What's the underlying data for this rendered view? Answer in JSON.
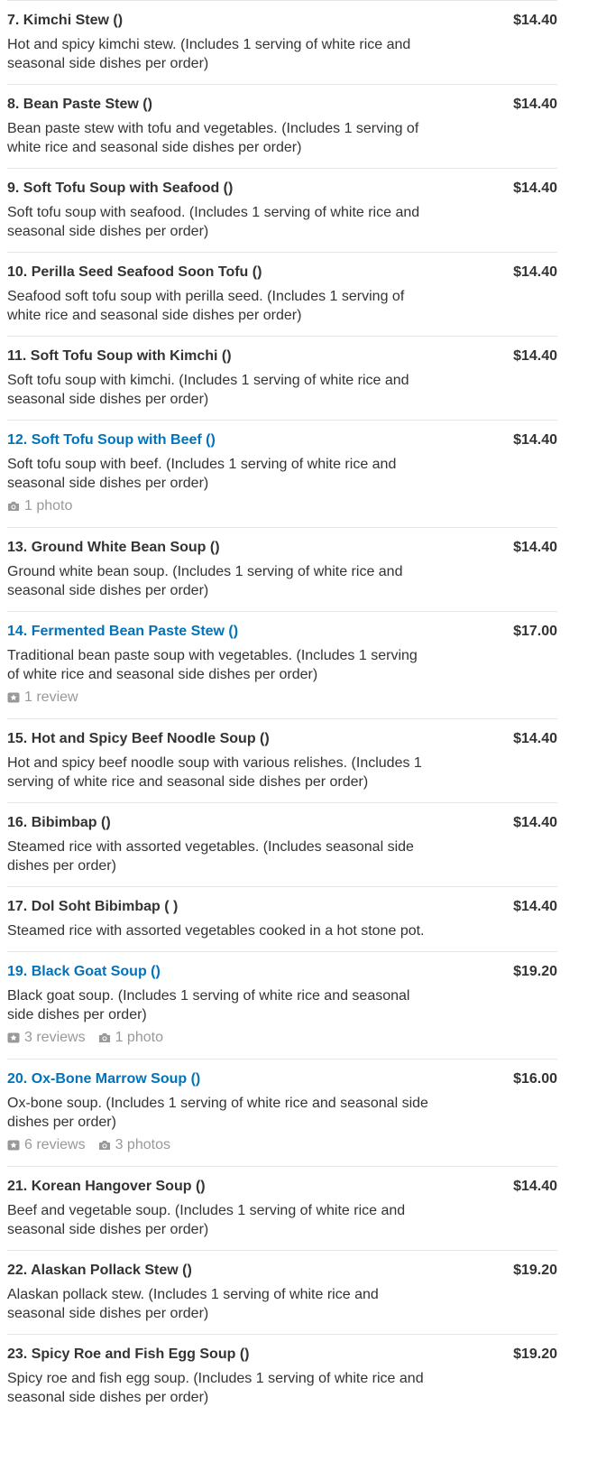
{
  "items": [
    {
      "name": "7. Kimchi Stew ()",
      "price": "$14.40",
      "linked": false,
      "desc": "Hot and spicy kimchi stew. (Includes 1 serving of white rice and seasonal side dishes per order)"
    },
    {
      "name": "8. Bean Paste Stew ()",
      "price": "$14.40",
      "linked": false,
      "desc": "Bean paste stew with tofu and vegetables. (Includes 1 serving of white rice and seasonal side dishes per order)"
    },
    {
      "name": "9. Soft Tofu Soup with Seafood ()",
      "price": "$14.40",
      "linked": false,
      "desc": "Soft tofu soup with seafood. (Includes 1 serving of white rice and seasonal side dishes per order)"
    },
    {
      "name": "10. Perilla Seed Seafood Soon Tofu ()",
      "price": "$14.40",
      "linked": false,
      "desc": "Seafood soft tofu soup with perilla seed. (Includes 1 serving of white rice and seasonal side dishes per order)"
    },
    {
      "name": "11. Soft Tofu Soup with Kimchi ()",
      "price": "$14.40",
      "linked": false,
      "desc": "Soft tofu soup with kimchi. (Includes 1 serving of white rice and seasonal side dishes per order)"
    },
    {
      "name": "12. Soft Tofu Soup with Beef ()",
      "price": "$14.40",
      "linked": true,
      "desc": "Soft tofu soup with beef. (Includes 1 serving of white rice and seasonal side dishes per order)",
      "photos": "1 photo"
    },
    {
      "name": "13. Ground White Bean Soup ()",
      "price": "$14.40",
      "linked": false,
      "desc": "Ground white bean soup. (Includes 1 serving of white rice and seasonal side dishes per order)"
    },
    {
      "name": "14. Fermented Bean Paste Stew ()",
      "price": "$17.00",
      "linked": true,
      "desc": "Traditional bean paste soup with vegetables. (Includes 1 serving of white rice and seasonal side dishes per order)",
      "reviews": "1 review"
    },
    {
      "name": "15. Hot and Spicy Beef Noodle Soup ()",
      "price": "$14.40",
      "linked": false,
      "desc": "Hot and spicy beef noodle soup with various relishes. (Includes 1 serving of white rice and seasonal side dishes per order)"
    },
    {
      "name": "16. Bibimbap ()",
      "price": "$14.40",
      "linked": false,
      "desc": "Steamed rice with assorted vegetables. (Includes seasonal side dishes per order)"
    },
    {
      "name": "17. Dol Soht Bibimbap ( )",
      "price": "$14.40",
      "linked": false,
      "desc": "Steamed rice with assorted vegetables cooked in a hot stone pot."
    },
    {
      "name": "19. Black Goat Soup ()",
      "price": "$19.20",
      "linked": true,
      "desc": "Black goat soup. (Includes 1 serving of white rice and seasonal side dishes per order)",
      "reviews": "3 reviews",
      "photos": "1 photo"
    },
    {
      "name": "20. Ox-Bone Marrow Soup ()",
      "price": "$16.00",
      "linked": true,
      "desc": "Ox-bone soup. (Includes 1 serving of white rice and seasonal side dishes per order)",
      "reviews": "6 reviews",
      "photos": "3 photos"
    },
    {
      "name": "21. Korean Hangover Soup ()",
      "price": "$14.40",
      "linked": false,
      "desc": "Beef and vegetable soup. (Includes 1 serving of white rice and seasonal side dishes per order)"
    },
    {
      "name": "22. Alaskan Pollack Stew ()",
      "price": "$19.20",
      "linked": false,
      "desc": "Alaskan pollack stew. (Includes 1 serving of white rice and seasonal side dishes per order)"
    },
    {
      "name": "23. Spicy Roe and Fish Egg Soup ()",
      "price": "$19.20",
      "linked": false,
      "desc": "Spicy roe and fish egg soup. (Includes 1 serving of white rice and seasonal side dishes per order)"
    }
  ],
  "colors": {
    "link": "#0073bb",
    "text": "#333333",
    "meta": "#999999",
    "divider": "#e6e6e6"
  },
  "icons": {
    "review": "review-star-icon",
    "photo": "camera-icon"
  }
}
